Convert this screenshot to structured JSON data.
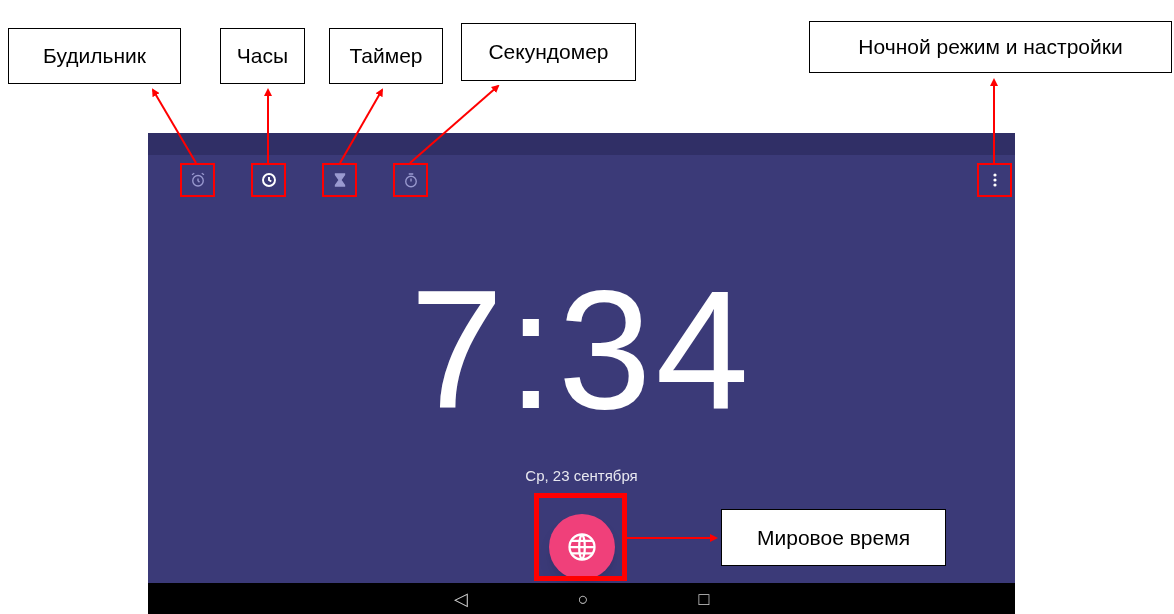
{
  "annotations": [
    {
      "label": "Будильник"
    },
    {
      "label": "Часы"
    },
    {
      "label": "Таймер"
    },
    {
      "label": "Секундомер"
    },
    {
      "label": "Ночной режим и настройки"
    },
    {
      "label": "Мировое время"
    }
  ],
  "tabs": [
    {
      "kind": "alarm",
      "selected": false
    },
    {
      "kind": "clock",
      "selected": true
    },
    {
      "kind": "timer",
      "selected": false
    },
    {
      "kind": "stopwatch",
      "selected": false
    }
  ],
  "clock": {
    "time": "7:34",
    "date": "Ср, 23 сентября"
  },
  "nav_bar": {
    "back": "◁",
    "home": "○",
    "recents": "□"
  }
}
